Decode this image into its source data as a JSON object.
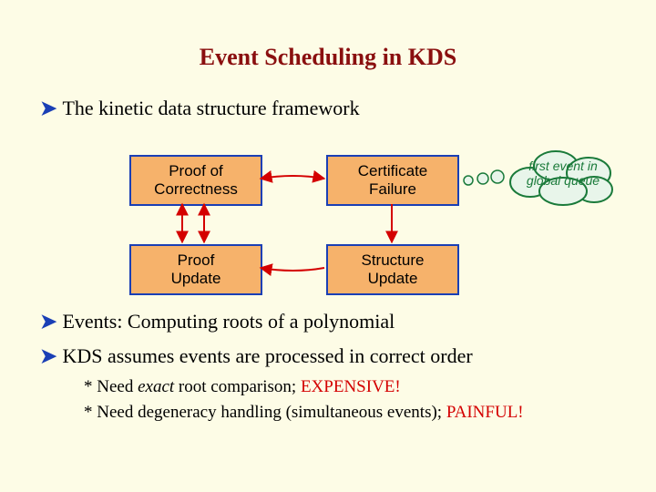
{
  "title": "Event Scheduling in KDS",
  "bullets": {
    "b1": "The kinetic data structure framework",
    "b2": "Events: Computing roots of a polynomial",
    "b3": "KDS assumes events are processed in correct order"
  },
  "subpoints": {
    "s1_prefix": "* Need ",
    "s1_em": "exact",
    "s1_mid": " root comparison; ",
    "s1_red": "EXPENSIVE!",
    "s2_prefix": "* Need degeneracy handling (simultaneous events); ",
    "s2_red": "PAINFUL!"
  },
  "boxes": {
    "proof_correctness_l1": "Proof of",
    "proof_correctness_l2": "Correctness",
    "certificate_l1": "Certificate",
    "certificate_l2": "Failure",
    "proof_update_l1": "Proof",
    "proof_update_l2": "Update",
    "structure_l1": "Structure",
    "structure_l2": "Update"
  },
  "cloud": {
    "l1": "first event in",
    "l2": "global queue"
  },
  "colors": {
    "background": "#fdfce6",
    "title": "#8a0f0f",
    "bullet_arrow": "#1a3fb5",
    "box_border": "#1a3fb5",
    "box_fill": "#f6b26b",
    "arrow_red": "#d40000",
    "cloud_stroke": "#1a7a3a",
    "cloud_fill": "#e8f5ea"
  }
}
